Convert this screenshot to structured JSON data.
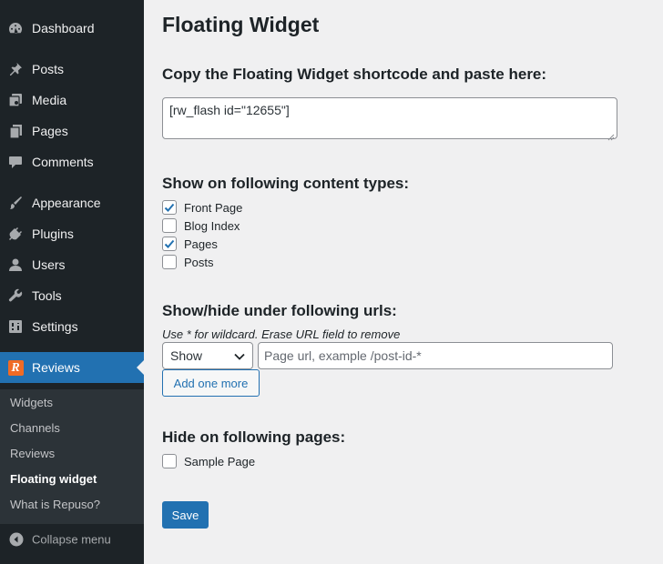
{
  "sidebar": {
    "items": [
      {
        "label": "Dashboard",
        "icon": "dashboard-icon"
      },
      {
        "label": "Posts",
        "icon": "pushpin-icon"
      },
      {
        "label": "Media",
        "icon": "media-icon"
      },
      {
        "label": "Pages",
        "icon": "pages-icon"
      },
      {
        "label": "Comments",
        "icon": "comment-icon"
      },
      {
        "label": "Appearance",
        "icon": "paintbrush-icon"
      },
      {
        "label": "Plugins",
        "icon": "plugin-icon"
      },
      {
        "label": "Users",
        "icon": "user-icon"
      },
      {
        "label": "Tools",
        "icon": "wrench-icon"
      },
      {
        "label": "Settings",
        "icon": "settings-icon"
      },
      {
        "label": "Reviews",
        "icon": "repuso-logo",
        "logo_letter": "R"
      }
    ],
    "submenu": [
      "Widgets",
      "Channels",
      "Reviews",
      "Floating widget",
      "What is Repuso?"
    ],
    "collapse_label": "Collapse menu"
  },
  "main": {
    "title": "Floating Widget",
    "shortcode_heading": "Copy the Floating Widget shortcode and paste here:",
    "shortcode_value": "[rw_flash id=\"12655\"]",
    "content_types_heading": "Show on following content types:",
    "content_types": [
      {
        "label": "Front Page",
        "checked": true
      },
      {
        "label": "Blog Index",
        "checked": false
      },
      {
        "label": "Pages",
        "checked": true
      },
      {
        "label": "Posts",
        "checked": false
      }
    ],
    "urls_heading": "Show/hide under following urls:",
    "urls_hint": "Use * for wildcard. Erase URL field to remove",
    "show_select_value": "Show",
    "url_placeholder": "Page url, example /post-id-*",
    "add_more_label": "Add one more",
    "hide_pages_heading": "Hide on following pages:",
    "hide_pages": [
      {
        "label": "Sample Page",
        "checked": false
      }
    ],
    "save_label": "Save"
  },
  "colors": {
    "sidebar_bg": "#1d2327",
    "submenu_bg": "#2c3338",
    "accent": "#2271b1",
    "brand_logo": "#f06b25",
    "page_bg": "#f0f0f1"
  }
}
